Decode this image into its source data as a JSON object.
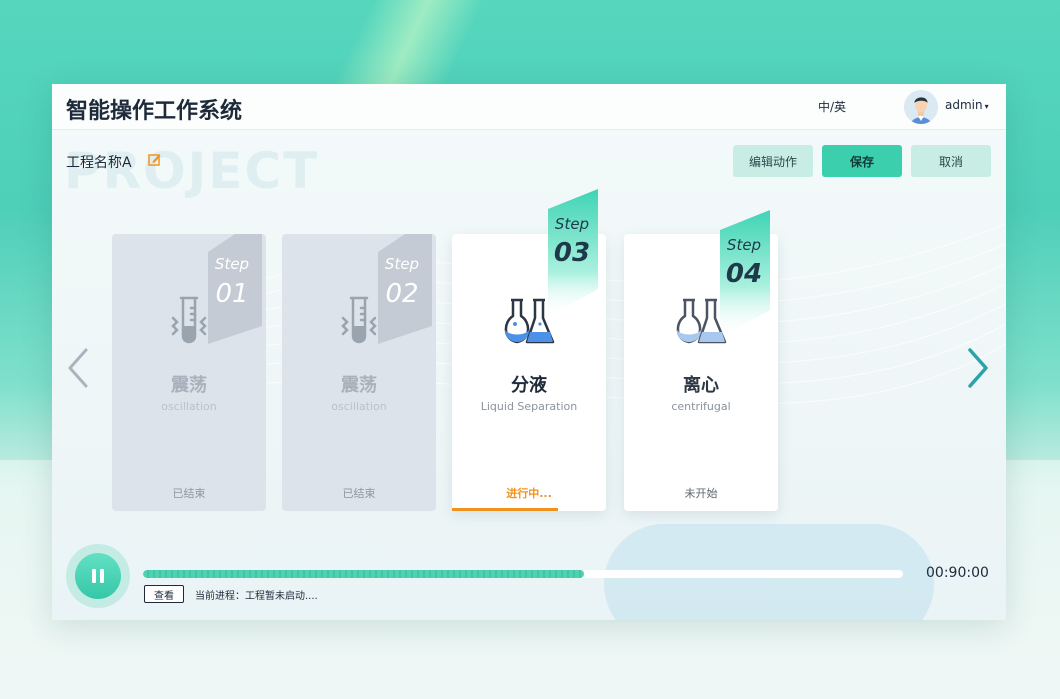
{
  "app": {
    "title": "智能操作工作系统",
    "watermark": "PROJECT"
  },
  "header": {
    "lang_switch": "中/英",
    "username": "admin",
    "caret": "▾"
  },
  "project": {
    "name": "工程名称A"
  },
  "toolbar": {
    "edit_label": "编辑动作",
    "save_label": "保存",
    "cancel_label": "取消"
  },
  "steps": [
    {
      "tag": "Step",
      "number": "01",
      "title_cn": "震荡",
      "title_en": "oscillation",
      "status": "已结束",
      "state": "done",
      "icon": "test-tube-shaking-icon"
    },
    {
      "tag": "Step",
      "number": "02",
      "title_cn": "震荡",
      "title_en": "oscillation",
      "status": "已结束",
      "state": "done",
      "icon": "test-tube-shaking-icon"
    },
    {
      "tag": "Step",
      "number": "03",
      "title_cn": "分液",
      "title_en": "Liquid Separation",
      "status": "进行中...",
      "state": "active",
      "icon": "flasks-icon"
    },
    {
      "tag": "Step",
      "number": "04",
      "title_cn": "离心",
      "title_en": "centrifugal",
      "status": "未开始",
      "state": "pending",
      "icon": "flasks-icon"
    }
  ],
  "player": {
    "progress_percent": 58,
    "time": "00:90:00",
    "view_label": "查看",
    "process_text": "当前进程：工程暂未启动...."
  },
  "colors": {
    "accent": "#3ccfae",
    "active_status": "#f0931e",
    "text": "#1e2a3a",
    "done_card": "#dde3ea"
  }
}
